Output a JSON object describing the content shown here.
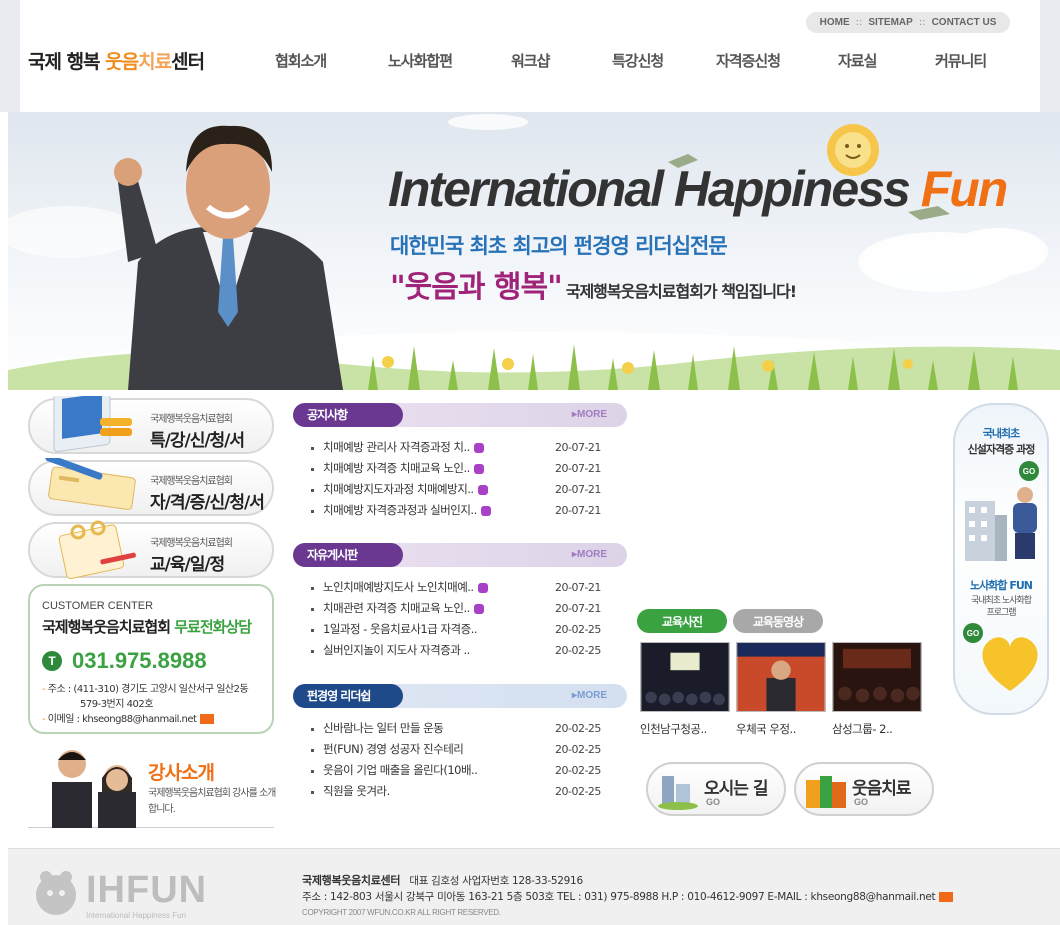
{
  "header": {
    "util_links": [
      "HOME",
      "SITEMAP",
      "CONTACT US"
    ],
    "logo": {
      "part1": "국제 행복 ",
      "part2": "웃음",
      "part3": "치료",
      "part4": "센터"
    },
    "nav": [
      "협회소개",
      "노사화합편",
      "워크샵",
      "특강신청",
      "자격증신청",
      "자료실",
      "커뮤니티"
    ]
  },
  "hero": {
    "title_main": "International Happiness",
    "title_fun": "Fun",
    "sub1": "대한민국 최초 최고의 펀경영 리더십전문",
    "sub2_quote": "\"웃음과 행복\"",
    "sub2_rest": "국제행복웃음치료협회가 책임집니다!"
  },
  "left": {
    "buttons": [
      {
        "small": "국제행복웃음치료협회",
        "big": "특/강/신/청/서"
      },
      {
        "small": "국제행복웃음치료협회",
        "big": "자/격/증/신/청/서"
      },
      {
        "small": "국제행복웃음치료협회",
        "big": "교/육/일/정"
      }
    ],
    "customer_center": {
      "label": "CUSTOMER CENTER",
      "title": "국제행복웃음치료협회",
      "title_green": "무료전화상담",
      "phone_badge": "T",
      "phone": "031.975.8988",
      "addr_line1": "주소 : (411-310) 경기도 고양시 일산서구 일산2동",
      "addr_line2": "579-3번지 402호",
      "email": "이메일 : khseong88@hanmail.net"
    },
    "teacher": {
      "title": "강사소개",
      "desc": "국제행복웃음치료협회 강사를 소개합니다."
    }
  },
  "boards": [
    {
      "name": "공지사항",
      "more": "MORE",
      "items": [
        {
          "title": "치매예방 관리사 자격증과정 치..",
          "new": true,
          "date": "20-07-21"
        },
        {
          "title": "치매예방 자격증 치매교육 노인..",
          "new": true,
          "date": "20-07-21"
        },
        {
          "title": "치매예방지도자과정 치매예방지..",
          "new": true,
          "date": "20-07-21"
        },
        {
          "title": "치매예방 자격증과정과 실버인지..",
          "new": true,
          "date": "20-07-21"
        }
      ]
    },
    {
      "name": "자유게시판",
      "more": "MORE",
      "items": [
        {
          "title": "노인치매예방지도사 노인치매예..",
          "new": true,
          "date": "20-07-21"
        },
        {
          "title": "치매관련 자격증 치매교육 노인..",
          "new": true,
          "date": "20-07-21"
        },
        {
          "title": "1일과정 - 웃음치료사1급 자격증..",
          "new": false,
          "date": "20-02-25"
        },
        {
          "title": "실버인지놀이 지도사 자격증과 ..",
          "new": false,
          "date": "20-02-25"
        }
      ]
    },
    {
      "name": "펀경영 리더쉽",
      "more": "MORE",
      "items": [
        {
          "title": "신바람나는 일터 만들 운동",
          "new": false,
          "date": "20-02-25"
        },
        {
          "title": "펀(FUN) 경영 성공자 진수테리",
          "new": false,
          "date": "20-02-25"
        },
        {
          "title": "웃음이 기업 매출을 올린다(10배..",
          "new": false,
          "date": "20-02-25"
        },
        {
          "title": "직원을 웃겨라.",
          "new": false,
          "date": "20-02-25"
        }
      ]
    }
  ],
  "photos": {
    "tabs": [
      "교육사진",
      "교육동영상"
    ],
    "items": [
      {
        "caption": "인천남구청공.."
      },
      {
        "caption": "우체국 우정.."
      },
      {
        "caption": "삼성그룹- 2.."
      }
    ]
  },
  "go_buttons": [
    {
      "label": "오시는 길",
      "go": "GO"
    },
    {
      "label": "웃음치료",
      "go": "GO"
    }
  ],
  "right_banner": {
    "t1": "국내최초",
    "t2": "신설자격증 과정",
    "t3": "노사화합 FUN",
    "t4a": "국내최초 노사화합",
    "t4b": "프로그램",
    "go": "GO"
  },
  "footer": {
    "logo_text": "IHFUN",
    "logo_sub": "International Happiness Fun",
    "line1_name": "국제행복웃음치료센터",
    "line1_rest": "대표 김호성   사업자번호 128-33-52916",
    "line2": "주소 : 142-803 서울시 강북구 미아동 163-21 5층 503호   TEL : 031) 975-8988  H.P : 010-4612-9097  E-MAIL : khseong88@hanmail.net",
    "copyright": "COPYRIGHT 2007 WFUN.CO.KR ALL RIGHT RESERVED."
  }
}
